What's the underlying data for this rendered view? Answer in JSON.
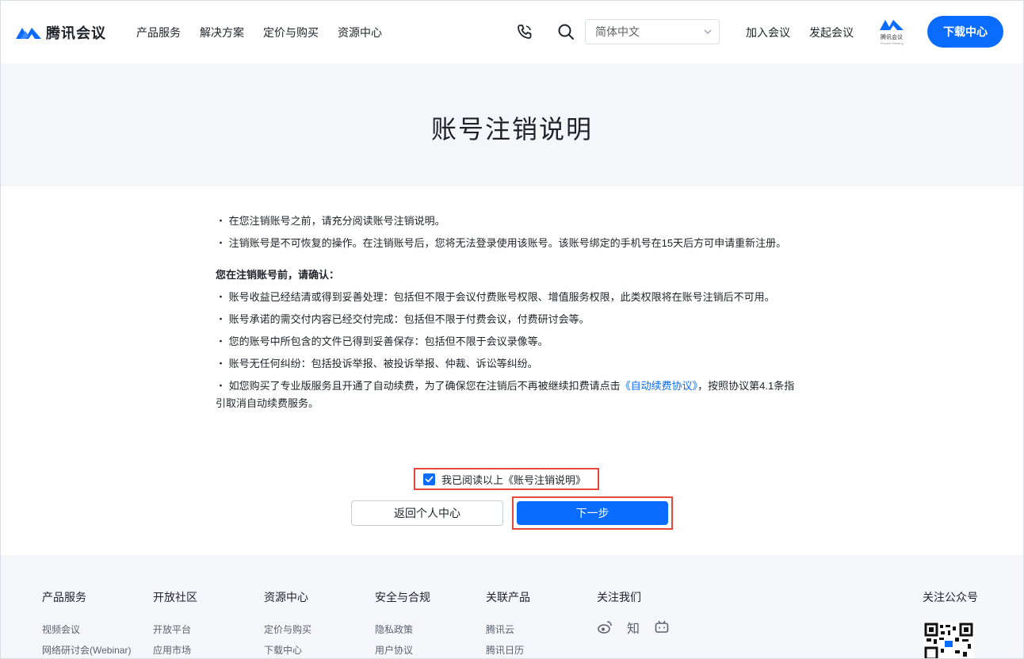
{
  "header": {
    "logo_text": "腾讯会议",
    "nav": [
      "产品服务",
      "解决方案",
      "定价与购买",
      "资源中心"
    ],
    "language": "简体中文",
    "join": "加入会议",
    "start": "发起会议",
    "badge_title": "腾讯会议",
    "badge_sub": "Tencent Meeting",
    "download": "下载中心"
  },
  "banner": {
    "title": "账号注销说明"
  },
  "content": {
    "p1": "・ 在您注销账号之前，请充分阅读账号注销说明。",
    "p2": "・ 注销账号是不可恢复的操作。在注销账号后，您将无法登录使用该账号。该账号绑定的手机号在15天后方可申请重新注册。",
    "confirm_title": "您在注销账号前，请确认：",
    "c1": "・ 账号收益已经结清或得到妥善处理：包括但不限于会议付费账号权限、增值服务权限，此类权限将在账号注销后不可用。",
    "c2": "・ 账号承诺的需交付内容已经交付完成：包括但不限于付费会议，付费研讨会等。",
    "c3": "・ 您的账号中所包含的文件已得到妥善保存：包括但不限于会议录像等。",
    "c4": "・ 账号无任何纠纷：包括投诉举报、被投诉举报、仲裁、诉讼等纠纷。",
    "c5_pre": "・ 如您购买了专业版服务且开通了自动续费，为了确保您在注销后不再被继续扣费请点击",
    "c5_link": "《自动续费协议》",
    "c5_post": "，按照协议第4.1条指引取消自动续费服务。"
  },
  "agree": {
    "label": "我已阅读以上《账号注销说明》",
    "checked": true
  },
  "buttons": {
    "back": "返回个人中心",
    "next": "下一步"
  },
  "footer": {
    "cols": [
      {
        "title": "产品服务",
        "items": [
          "视频会议",
          "网络研讨会(Webinar)"
        ]
      },
      {
        "title": "开放社区",
        "items": [
          "开放平台",
          "应用市场"
        ]
      },
      {
        "title": "资源中心",
        "items": [
          "定价与购买",
          "下载中心"
        ]
      },
      {
        "title": "安全与合规",
        "items": [
          "隐私政策",
          "用户协议"
        ]
      },
      {
        "title": "关联产品",
        "items": [
          "腾讯云",
          "腾讯日历"
        ]
      }
    ],
    "follow": "关注我们",
    "social_zhihu": "知",
    "wechat": "关注公众号"
  },
  "colors": {
    "primary": "#0a6cff",
    "highlight": "#e3483a",
    "banner_bg": "#f5f6f9"
  }
}
